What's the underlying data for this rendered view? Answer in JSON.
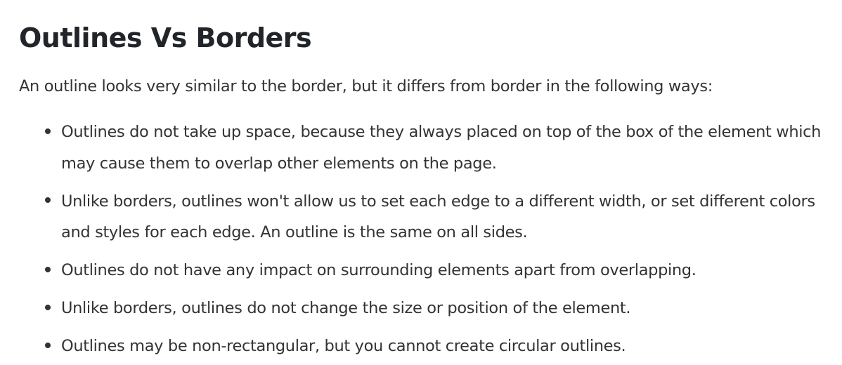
{
  "heading": "Outlines Vs Borders",
  "intro": "An outline looks very similar to the border, but it differs from border in the following ways:",
  "points": [
    "Outlines do not take up space, because they always placed on top of the box of the element which may cause them to overlap other elements on the page.",
    "Unlike borders, outlines won't allow us to set each edge to a different width, or set different colors and styles for each edge. An outline is the same on all sides.",
    "Outlines do not have any impact on surrounding elements apart from overlapping.",
    "Unlike borders, outlines do not change the size or position of the element.",
    "Outlines may be non-rectangular, but you cannot create circular outlines."
  ]
}
